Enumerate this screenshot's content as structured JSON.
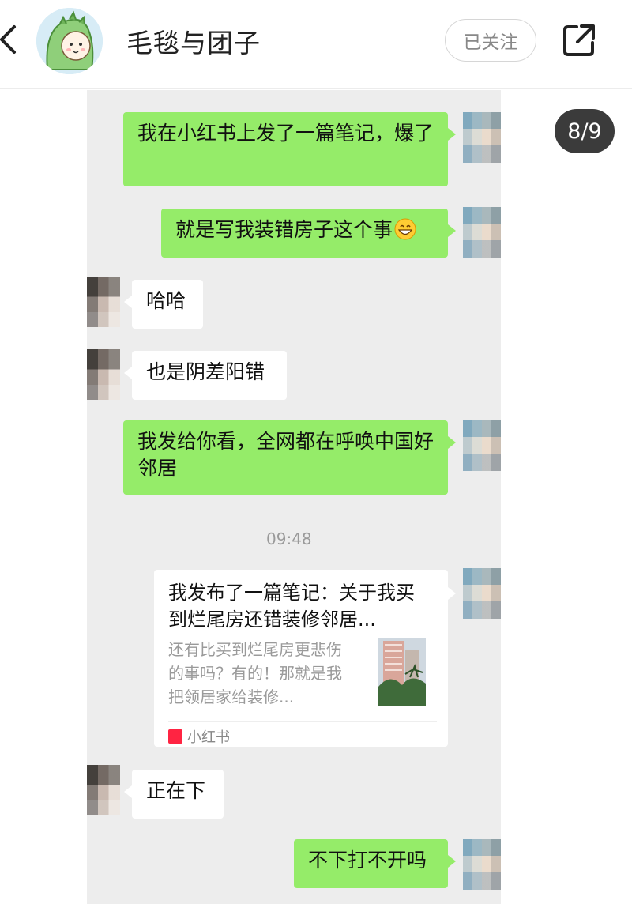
{
  "header": {
    "title": "毛毯与团子",
    "follow_label": "已关注"
  },
  "page_counter": "8/9",
  "chat": {
    "messages": [
      {
        "side": "right",
        "text": "我在小红书上发了一篇笔记，爆了"
      },
      {
        "side": "right",
        "text": "就是写我装错房子这个事"
      },
      {
        "side": "left",
        "text": "哈哈"
      },
      {
        "side": "left",
        "text": "也是阴差阳错"
      },
      {
        "side": "right",
        "text": "我发给你看，全网都在呼唤中国好邻居"
      }
    ],
    "timestamp": "09:48",
    "shared_card": {
      "title": "我发布了一篇笔记：关于我买到烂尾房还错装修邻居...",
      "description": "还有比买到烂尾房更悲伤的事吗？有的！那就是我把领居家给装修...",
      "source": "小红书"
    },
    "messages_after": [
      {
        "side": "left",
        "text": "正在下"
      },
      {
        "side": "right",
        "text": "不下打不开吗"
      }
    ]
  },
  "colors": {
    "my_bubble": "#95ec69",
    "other_bubble": "#ffffff",
    "chat_background": "#ededed",
    "brand_red": "#ff2442"
  },
  "icons": [
    "back-arrow-icon",
    "grin-emoji-icon",
    "share-external-icon",
    "xiaohongshu-logo-icon"
  ]
}
